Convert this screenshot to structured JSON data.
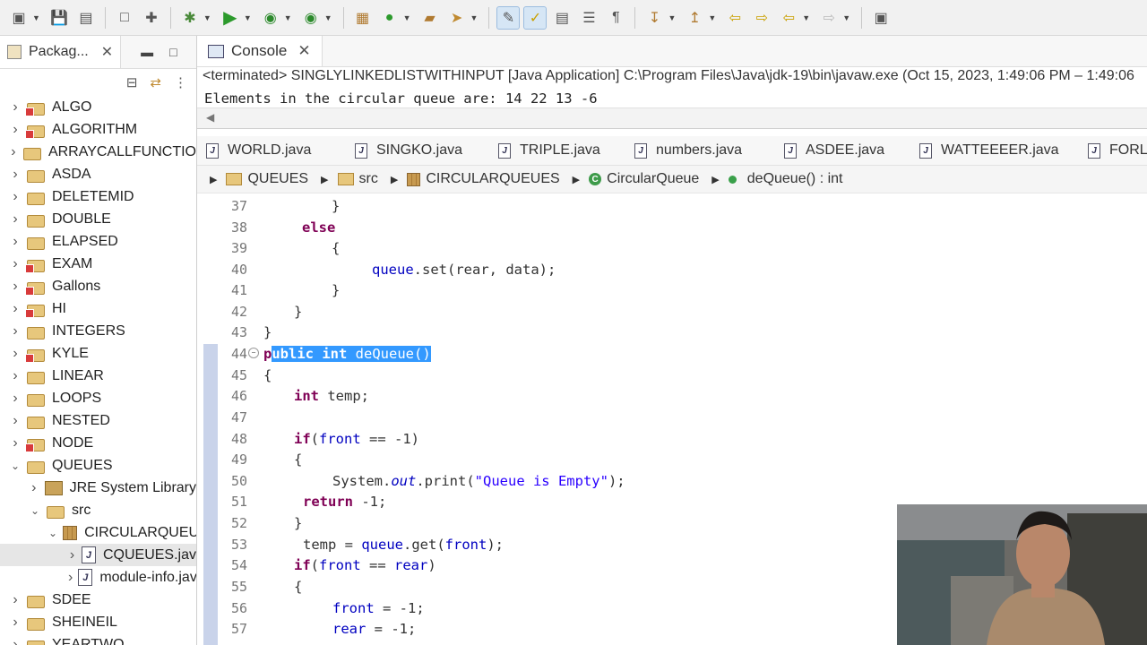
{
  "left_panel": {
    "tab_label": "Packag...",
    "tree": [
      {
        "label": "ALGO",
        "type": "project",
        "error": true
      },
      {
        "label": "ALGORITHM",
        "type": "project",
        "error": true
      },
      {
        "label": "ARRAYCALLFUNCTIO",
        "type": "project",
        "error": false
      },
      {
        "label": "ASDA",
        "type": "project",
        "error": false
      },
      {
        "label": "DELETEMID",
        "type": "project",
        "error": false
      },
      {
        "label": "DOUBLE",
        "type": "project",
        "error": false
      },
      {
        "label": "ELAPSED",
        "type": "project",
        "error": false
      },
      {
        "label": "EXAM",
        "type": "project",
        "error": true
      },
      {
        "label": "Gallons",
        "type": "project",
        "error": true
      },
      {
        "label": "HI",
        "type": "project",
        "error": true
      },
      {
        "label": "INTEGERS",
        "type": "project",
        "error": false
      },
      {
        "label": "KYLE",
        "type": "project",
        "error": true
      },
      {
        "label": "LINEAR",
        "type": "project",
        "error": false
      },
      {
        "label": "LOOPS",
        "type": "project",
        "error": false
      },
      {
        "label": "NESTED",
        "type": "project",
        "error": false
      },
      {
        "label": "NODE",
        "type": "project",
        "error": true
      },
      {
        "label": "QUEUES",
        "type": "project",
        "error": false,
        "expanded": true
      },
      {
        "label": "JRE System Library",
        "type": "library"
      },
      {
        "label": "src",
        "type": "folder",
        "expanded": true
      },
      {
        "label": "CIRCULARQUEU",
        "type": "package",
        "expanded": true
      },
      {
        "label": "CQUEUES.jav",
        "type": "javafile",
        "selected": true
      },
      {
        "label": "module-info.jav",
        "type": "javafile"
      },
      {
        "label": "SDEE",
        "type": "project",
        "error": false
      },
      {
        "label": "SHEINEIL",
        "type": "project",
        "error": false
      },
      {
        "label": "YEARTWO",
        "type": "project",
        "error": false
      }
    ]
  },
  "console": {
    "tab_label": "Console",
    "status": "<terminated> SINGLYLINKEDLISTWITHINPUT [Java Application] C:\\Program Files\\Java\\jdk-19\\bin\\javaw.exe  (Oct 15, 2023, 1:49:06 PM – 1:49:06",
    "output": "Elements in the circular queue are: 14 22 13 -6"
  },
  "editor_tabs": [
    "WORLD.java",
    "SINGKO.java",
    "TRIPLE.java",
    "numbers.java",
    "ASDEE.java",
    "WATTEEEER.java",
    "FORLO"
  ],
  "breadcrumb": [
    "QUEUES",
    "src",
    "CIRCULARQUEUES",
    "CircularQueue",
    "deQueue() : int"
  ],
  "code": {
    "line_numbers": [
      "37",
      "38",
      "39",
      "40",
      "41",
      "42",
      "43",
      "44",
      "45",
      "46",
      "47",
      "48",
      "49",
      "50",
      "51",
      "52",
      "53",
      "54",
      "55",
      "56",
      "57"
    ],
    "l37": "}",
    "l38_kw": "else",
    "l39": "{",
    "l40_a": "queue",
    "l40_b": ".set(rear, data);",
    "l41": "}",
    "l42": "}",
    "l43": "}",
    "l44_p": "p",
    "l44_kw": "ublic int",
    "l44_rest": " deQueue()",
    "l45": "{",
    "l46_kw": "int",
    "l46_rest": " temp;",
    "l48_kw": "if",
    "l48_a": "(",
    "l48_f": "front",
    "l48_rest": " == -1)",
    "l49": "{",
    "l50_a": "System.",
    "l50_out": "out",
    "l50_b": ".print(",
    "l50_str": "\"Queue is Empty\"",
    "l50_c": ");",
    "l51_kw": "return",
    "l51_rest": " -1;",
    "l52": "}",
    "l53_a": "temp = ",
    "l53_q": "queue",
    "l53_b": ".get(",
    "l53_f": "front",
    "l53_c": ");",
    "l54_kw": "if",
    "l54_a": "(",
    "l54_f": "front",
    "l54_b": " == ",
    "l54_r": "rear",
    "l54_c": ")",
    "l55": "{",
    "l56_f": "front",
    "l56_rest": " = -1;",
    "l57_r": "rear",
    "l57_rest": " = -1;"
  },
  "colors": {
    "keyword": "#7f0055",
    "field": "#0000c0",
    "string": "#2a00ff",
    "selection": "#3399ff"
  }
}
